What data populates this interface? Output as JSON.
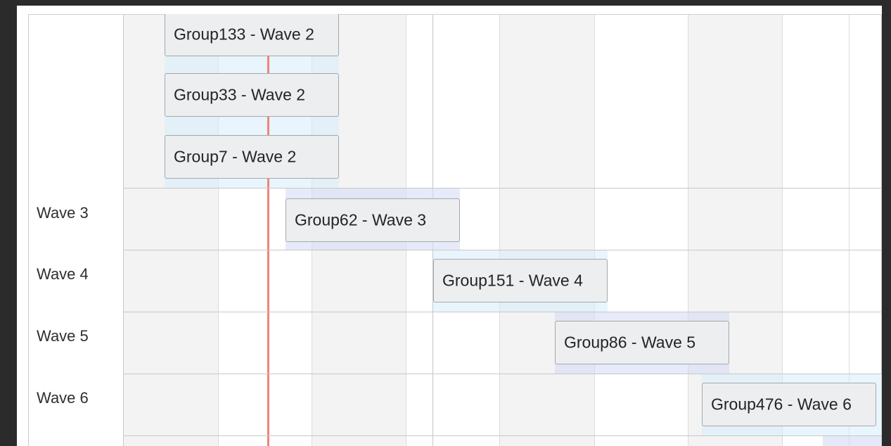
{
  "colors": {
    "page_background": "#2b2b2b",
    "panel_background": "#ffffff",
    "shaded_column": "#f3f3f3",
    "current_time_marker": "#f0857a",
    "item_background": "#eceeef",
    "item_border": "#a5a8ab"
  },
  "groups": [
    {
      "label": ""
    },
    {
      "label": "Wave 3"
    },
    {
      "label": "Wave 4"
    },
    {
      "label": "Wave 5"
    },
    {
      "label": "Wave 6"
    }
  ],
  "items": [
    {
      "label": "Group133 - Wave 2"
    },
    {
      "label": "Group33 - Wave 2"
    },
    {
      "label": "Group7 - Wave 2"
    },
    {
      "label": "Group62 - Wave 3"
    },
    {
      "label": "Group151 - Wave 4"
    },
    {
      "label": "Group86 - Wave 5"
    },
    {
      "label": "Group476 - Wave 6"
    }
  ]
}
